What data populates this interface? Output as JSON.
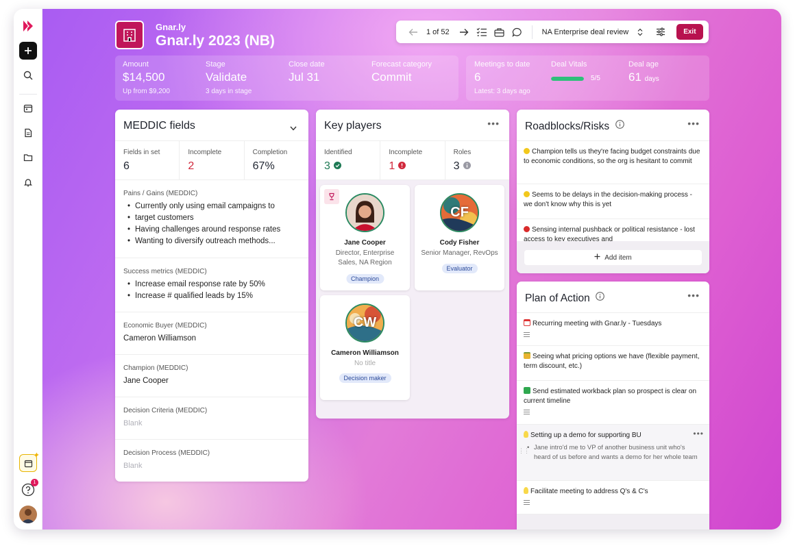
{
  "header": {
    "company": "Gnar.ly",
    "deal_title": "Gnar.ly 2023 (NB)"
  },
  "toolbar": {
    "pager": "1 of 52",
    "view_name": "NA Enterprise deal review",
    "exit_label": "Exit"
  },
  "stats": {
    "amount": {
      "label": "Amount",
      "value": "$14,500",
      "sub": "Up from $9,200"
    },
    "stage": {
      "label": "Stage",
      "value": "Validate",
      "sub": "3 days in stage"
    },
    "close_date": {
      "label": "Close date",
      "value": "Jul 31"
    },
    "forecast": {
      "label": "Forecast category",
      "value": "Commit"
    },
    "meetings": {
      "label": "Meetings to date",
      "value": "6",
      "sub": "Latest: 3 days ago"
    },
    "vitals": {
      "label": "Deal Vitals",
      "value": "5/5",
      "fill": 1.0,
      "color": "#2fbf7a"
    },
    "age": {
      "label": "Deal age",
      "value": "61",
      "unit": "days"
    }
  },
  "meddic": {
    "title": "MEDDIC fields",
    "stats": [
      {
        "label": "Fields in set",
        "value": "6"
      },
      {
        "label": "Incomplete",
        "value": "2"
      },
      {
        "label": "Completion",
        "value": "67%"
      }
    ],
    "pains": {
      "heading": "Pains / Gains (MEDDIC)",
      "items": [
        "Currently only using email campaigns to",
        "target customers",
        "Having challenges around response rates",
        "Wanting to diversify outreach methods..."
      ]
    },
    "success": {
      "heading": "Success metrics (MEDDIC)",
      "items": [
        "Increase email response rate by 50%",
        "Increase # qualified leads by 15%"
      ]
    },
    "economic_buyer": {
      "heading": "Economic Buyer (MEDDIC)",
      "value": "Cameron Williamson"
    },
    "champion": {
      "heading": "Champion (MEDDIC)",
      "value": "Jane Cooper"
    },
    "criteria": {
      "heading": "Decision Criteria (MEDDIC)",
      "value": "Blank"
    },
    "process": {
      "heading": "Decision Process (MEDDIC)",
      "value": "Blank"
    }
  },
  "key_players": {
    "title": "Key players",
    "stats": [
      {
        "label": "Identified",
        "value": "3"
      },
      {
        "label": "Incomplete",
        "value": "1"
      },
      {
        "label": "Roles",
        "value": "3"
      }
    ],
    "players": [
      {
        "name": "Jane Cooper",
        "title": "Director, Enterprise Sales, NA Region",
        "role": "Champion"
      },
      {
        "name": "Cody Fisher",
        "title": "Senior Manager, RevOps",
        "role": "Evaluator",
        "initials": "CF"
      },
      {
        "name": "Cameron Williamson",
        "title": "No title",
        "role": "Decision maker",
        "initials": "CW"
      }
    ]
  },
  "roadblocks": {
    "title": "Roadblocks/Risks",
    "items": [
      {
        "text": "Champion tells us they're facing budget constraints due to economic conditions, so the org is hesitant to commit",
        "color": "#f2c81c"
      },
      {
        "text": "Seems to be delays in the decision-making process - we don't know why this is yet",
        "color": "#f2c81c"
      },
      {
        "text": "Sensing internal pushback or political resistance - lost access to key executives and",
        "color": "#d92b2b"
      }
    ],
    "add_label": "Add item"
  },
  "plan": {
    "title": "Plan of Action",
    "items": [
      {
        "text": "Recurring meeting with Gnar.ly - Tuesdays"
      },
      {
        "text": "Seeing what pricing options we have (flexible payment, term discount, etc.)"
      },
      {
        "text": "Send estimated workback plan so prospect is clear on current timeline"
      },
      {
        "text": "Setting up a demo for supporting BU",
        "sub": "Jane intro'd me to VP of another business unit who's heard of us before and wants a demo for her whole team"
      },
      {
        "text": "Facilitate meeting to address Q's & C's"
      }
    ]
  },
  "sidebar": {
    "help_badge": "1"
  }
}
